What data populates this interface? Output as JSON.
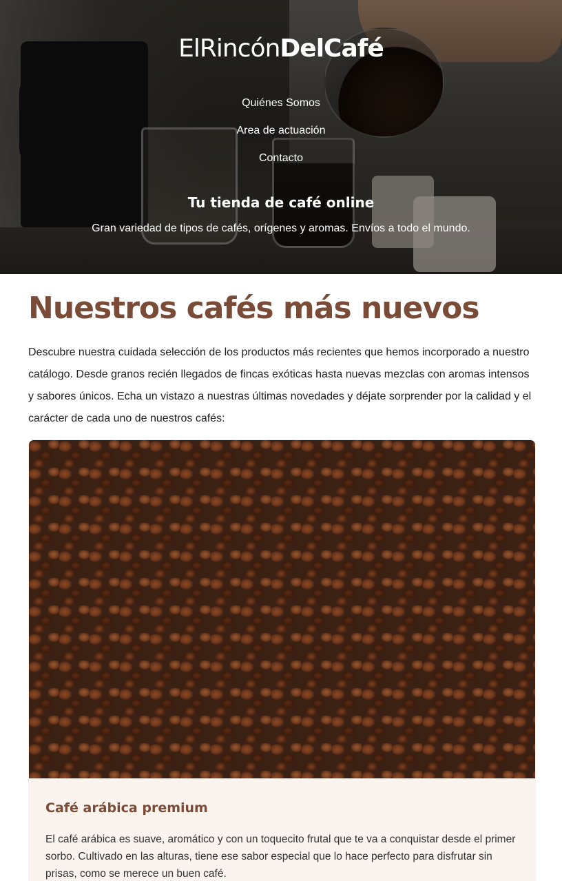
{
  "header": {
    "logo": {
      "part1": "ElRincón",
      "part2": "DelCafé"
    },
    "nav": [
      {
        "label": "Quiénes Somos"
      },
      {
        "label": "Area de actuación"
      },
      {
        "label": "Contacto"
      }
    ],
    "tagline": "Tu tienda de café online",
    "subtagline": "Gran variedad de tipos de cafés, orígenes y aromas. Envíos a todo el mundo."
  },
  "main": {
    "title": "Nuestros cafés más nuevos",
    "intro": "Descubre nuestra cuidada selección de los productos más recientes que hemos incorporado a nuestro catálogo. Desde granos recién llegados de fincas exóticas hasta nuevas mezclas con aromas intensos y sabores únicos. Echa un vistazo a nuestras últimas novedades y déjate sorprender por la calidad y el carácter de cada uno de nuestros cafés:",
    "products": [
      {
        "title": "Café arábica premium",
        "description": "El café arábica es suave, aromático y con un toquecito frutal que te va a conquistar desde el primer sorbo. Cultivado en las alturas, tiene ese sabor especial que lo hace perfecto para disfrutar sin prisas, como se merece un buen café."
      }
    ]
  },
  "colors": {
    "accent": "#7a4b36",
    "card_background": "#fbf3ee"
  }
}
